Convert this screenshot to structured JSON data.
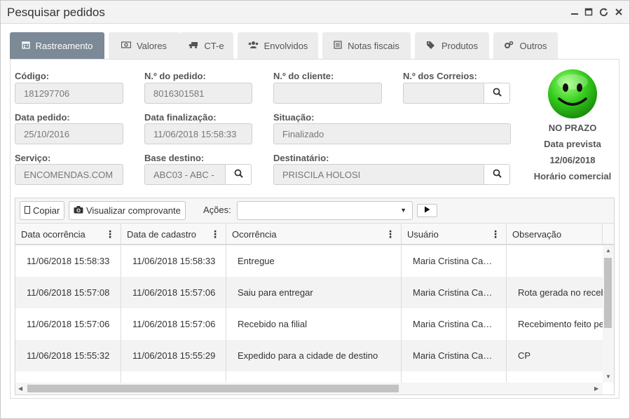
{
  "window": {
    "title": "Pesquisar pedidos",
    "controls": [
      "minimize-icon",
      "maximize-icon",
      "refresh-icon",
      "close-icon"
    ]
  },
  "tabs": [
    {
      "label": "Rastreamento",
      "icon": "calendar-icon",
      "active": true
    },
    {
      "label": "Valores",
      "icon": "money-icon",
      "active": false
    },
    {
      "label": "CT-e",
      "icon": "truck-icon",
      "active": false
    },
    {
      "label": "Envolvidos",
      "icon": "users-icon",
      "active": false
    },
    {
      "label": "Notas fiscais",
      "icon": "list-icon",
      "active": false
    },
    {
      "label": "Produtos",
      "icon": "tags-icon",
      "active": false
    },
    {
      "label": "Outros",
      "icon": "cogs-icon",
      "active": false
    }
  ],
  "form": {
    "codigo": {
      "label": "Código:",
      "value": "181297706"
    },
    "pedido": {
      "label": "N.º do pedido:",
      "value": "8016301581"
    },
    "cliente": {
      "label": "N.º do cliente:",
      "value": ""
    },
    "correios": {
      "label": "N.º dos Correios:",
      "value": ""
    },
    "data_pedido": {
      "label": "Data pedido:",
      "value": "25/10/2016"
    },
    "data_finalizacao": {
      "label": "Data finalização:",
      "value": "11/06/2018 15:58:33"
    },
    "situacao": {
      "label": "Situação:",
      "value": "Finalizado"
    },
    "servico": {
      "label": "Serviço:",
      "value": "ENCOMENDAS.COM"
    },
    "base_destino": {
      "label": "Base destino:",
      "value": "ABC03 - ABC -"
    },
    "destinatario": {
      "label": "Destinatário:",
      "value": "PRISCILA HOLOSI"
    }
  },
  "status": {
    "label": "NO PRAZO",
    "prevista_label": "Data prevista",
    "prevista_date": "12/06/2018",
    "horario": "Horário comercial",
    "color": "#2ecc2e"
  },
  "toolbar": {
    "copiar": "Copiar",
    "visualizar": "Visualizar comprovante",
    "acoes_label": "Ações:",
    "acoes_value": ""
  },
  "table": {
    "columns": [
      "Data ocorrência",
      "Data de cadastro",
      "Ocorrência",
      "Usuário",
      "Observação"
    ],
    "rows": [
      [
        "11/06/2018 15:58:33",
        "11/06/2018 15:58:33",
        "Entregue",
        "Maria Cristina Ca…",
        ""
      ],
      [
        "11/06/2018 15:57:08",
        "11/06/2018 15:57:06",
        "Saiu para entregar",
        "Maria Cristina Ca…",
        "Rota gerada no recebimento"
      ],
      [
        "11/06/2018 15:57:06",
        "11/06/2018 15:57:06",
        "Recebido na filial",
        "Maria Cristina Ca…",
        "Recebimento feito pela filial"
      ],
      [
        "11/06/2018 15:55:32",
        "11/06/2018 15:55:29",
        "Expedido para a cidade de destino",
        "Maria Cristina Ca…",
        "CP"
      ],
      [
        "",
        "",
        "",
        "",
        ""
      ]
    ]
  }
}
